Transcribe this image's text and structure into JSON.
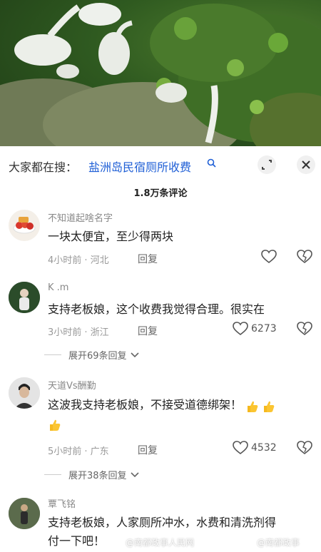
{
  "search": {
    "prefix": "大家都在搜：",
    "term": "盐洲岛民宿厕所收费"
  },
  "comment_count_label": "1.8万条评论",
  "comments": [
    {
      "username": "不知道起啥名字",
      "text": "一块太便宜，至少得两块",
      "meta": "4小时前 · 河北",
      "reply": "回复",
      "likes": ""
    },
    {
      "username": "K .m",
      "text": "支持老板娘，这个收费我觉得合理。很实在",
      "meta": "3小时前 · 浙江",
      "reply": "回复",
      "likes": "6273",
      "expand": "展开69条回复"
    },
    {
      "username": "天道Vs酬勤",
      "text": "这波我支持老板娘，不接受道德绑架！",
      "meta": "5小时前 · 广东",
      "reply": "回复",
      "likes": "4532",
      "expand": "展开38条回复"
    },
    {
      "username": "覃飞铭",
      "text_line1": "支持老板娘，人家厕所冲水，水费和清洗剂得",
      "text_line2": "付一下吧！"
    }
  ],
  "watermark": {
    "left": "@南都政事人民网",
    "right": "@南都政事"
  },
  "icons": {
    "search": "search-icon",
    "expand": "expand-icon",
    "close": "close-icon",
    "like": "heart-icon",
    "dislike": "broken-heart-icon",
    "chevron": "chevron-down-icon",
    "thumbs": "thumbs-up-emoji"
  },
  "colors": {
    "link_blue": "#1f5fd6",
    "meta_gray": "#999999"
  }
}
